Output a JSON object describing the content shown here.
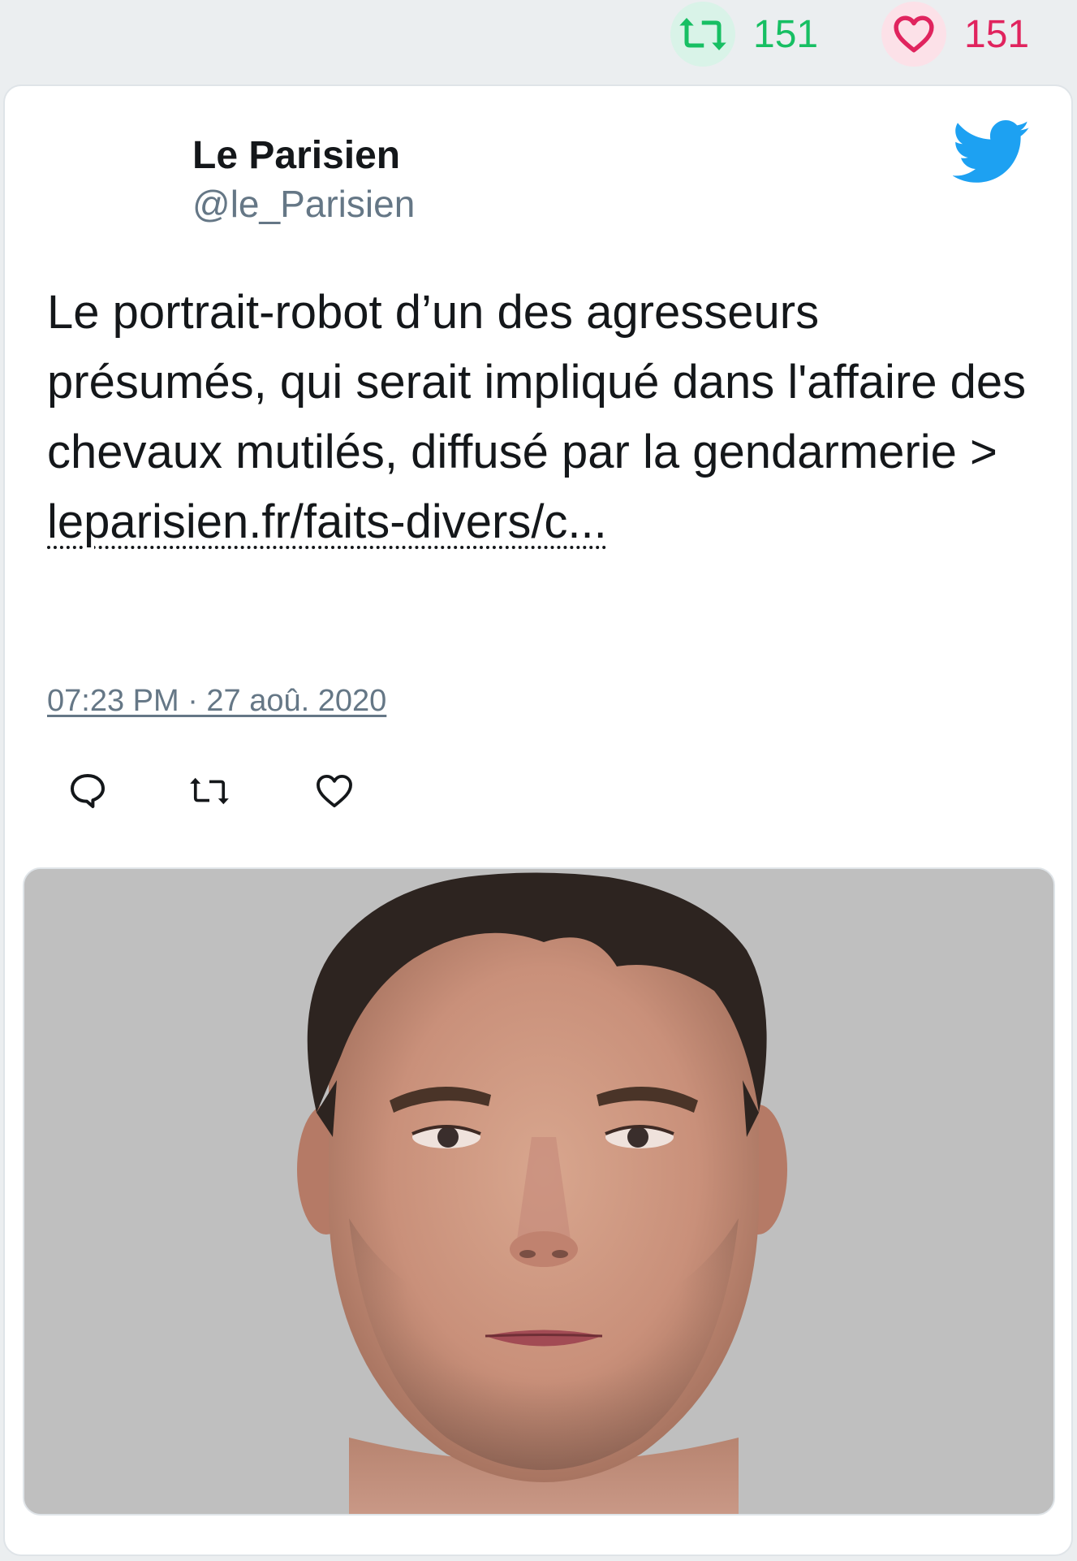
{
  "stats": {
    "retweets": "151",
    "likes": "151",
    "retweet_icon": "retweet-icon",
    "like_icon": "heart-icon",
    "retweet_color": "#17bf63",
    "like_color": "#e0245e"
  },
  "author": {
    "name": "Le Parisien",
    "handle": "@le_Parisien"
  },
  "tweet": {
    "text": "Le portrait-robot d’un des agresseurs présumés, qui serait impliqué dans l'affaire des chevaux mutilés, diffusé par la gendarmerie > ",
    "link_text": "leparisien.fr/faits-divers/c...",
    "timestamp": "07:23 PM · 27 aoû. 2020"
  },
  "actions": {
    "reply_icon": "reply-icon",
    "retweet_icon": "retweet-icon",
    "like_icon": "heart-icon"
  },
  "media": {
    "description_icon": "composite-sketch-photo",
    "background": "#bfbfbf"
  },
  "brand": {
    "logo_icon": "twitter-bird-icon",
    "logo_color": "#1da1f2"
  }
}
